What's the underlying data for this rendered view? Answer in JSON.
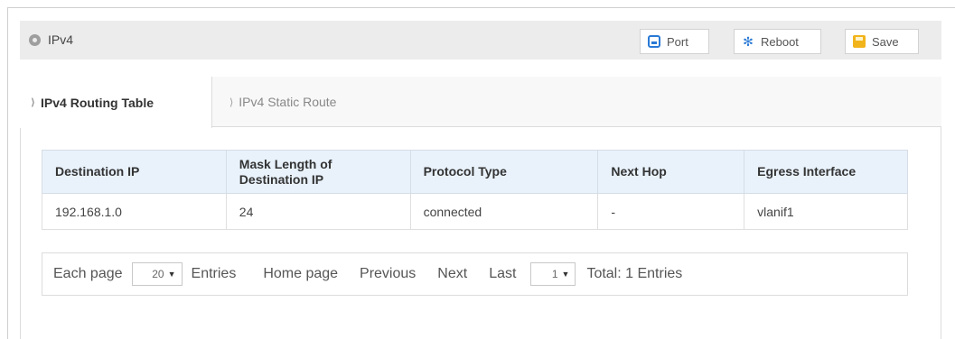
{
  "header": {
    "title": "IPv4",
    "buttons": {
      "port": "Port",
      "reboot": "Reboot",
      "save": "Save"
    }
  },
  "tabs": [
    {
      "label": "IPv4 Routing Table",
      "active": true
    },
    {
      "label": "IPv4 Static Route",
      "active": false
    }
  ],
  "table": {
    "headers": [
      "Destination IP",
      "Mask Length of Destination IP",
      "Protocol Type",
      "Next Hop",
      "Egress Interface"
    ],
    "rows": [
      [
        "192.168.1.0",
        "24",
        "connected",
        "-",
        "vlanif1"
      ]
    ]
  },
  "pager": {
    "each_page": "Each page",
    "page_size": "20",
    "entries": "Entries",
    "home": "Home page",
    "previous": "Previous",
    "next": "Next",
    "last": "Last",
    "current_page": "1",
    "total": "Total: 1 Entries"
  },
  "icons": {
    "location": "location-icon",
    "port": "port-icon",
    "reboot": "reboot-icon",
    "save": "save-icon"
  }
}
